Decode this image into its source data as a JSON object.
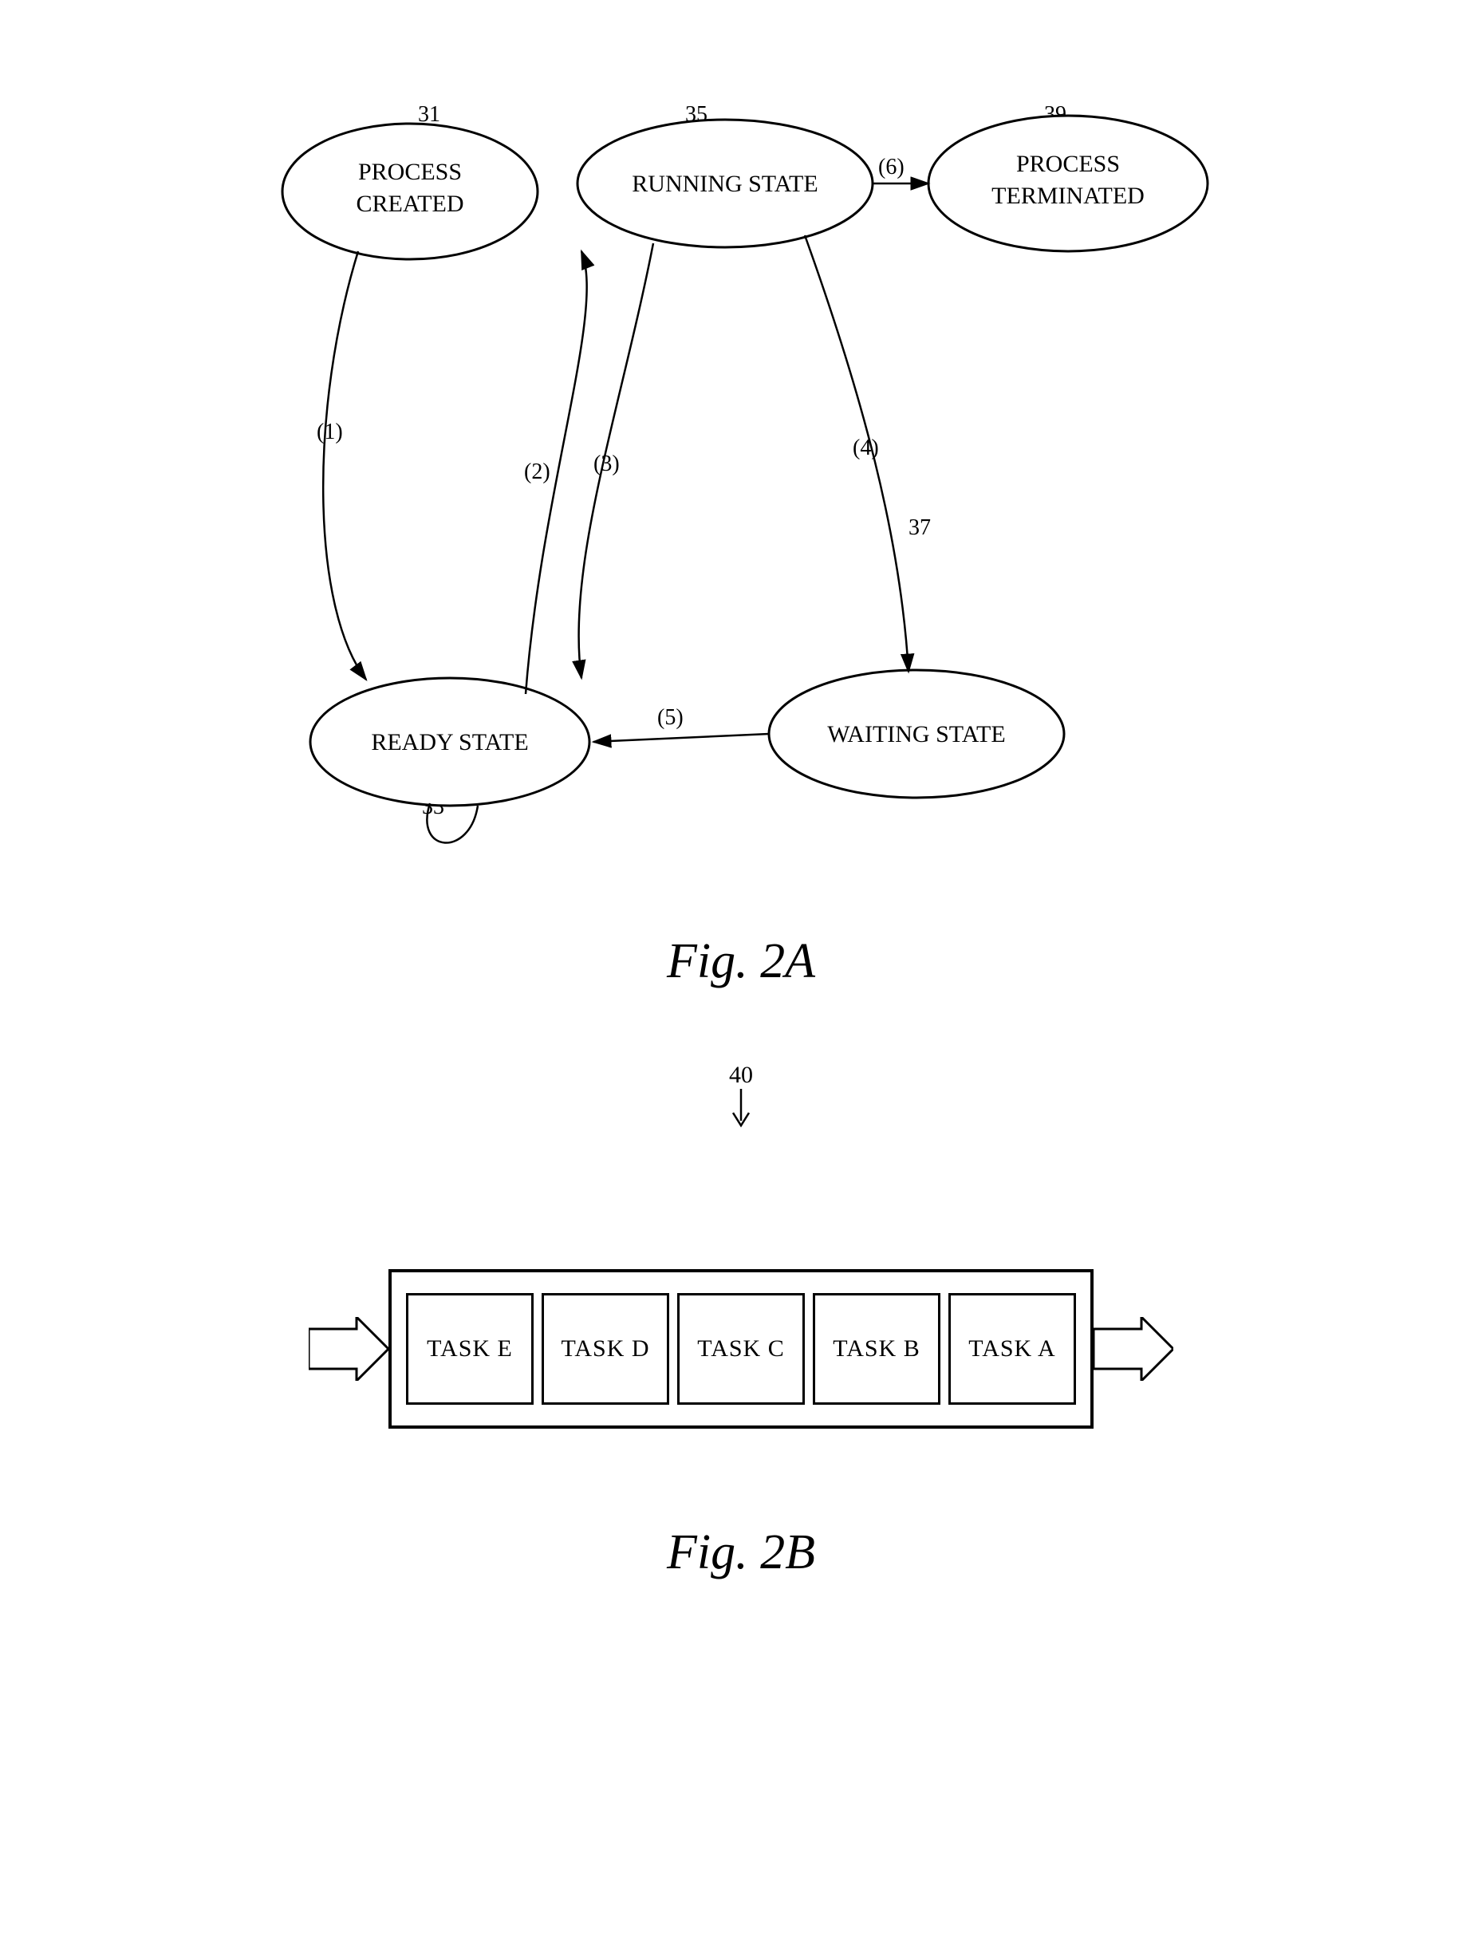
{
  "fig2a": {
    "title": "Fig. 2A",
    "nodes": {
      "process_created": {
        "label": "PROCESS\nCREATED",
        "ref": "31"
      },
      "running_state": {
        "label": "RUNNING STATE",
        "ref": "35"
      },
      "process_terminated": {
        "label": "PROCESS\nTERMINATED",
        "ref": "39"
      },
      "ready_state": {
        "label": "READY STATE",
        "ref": "33"
      },
      "waiting_state": {
        "label": "WAITING STATE",
        "ref": "37"
      }
    },
    "transitions": {
      "t1": "(1)",
      "t2": "(2)",
      "t3": "(3)",
      "t4": "(4)",
      "t5": "(5)",
      "t6": "(6)"
    }
  },
  "fig2b": {
    "title": "Fig. 2B",
    "ref": "40",
    "tasks": [
      "TASK E",
      "TASK D",
      "TASK C",
      "TASK B",
      "TASK A"
    ]
  }
}
